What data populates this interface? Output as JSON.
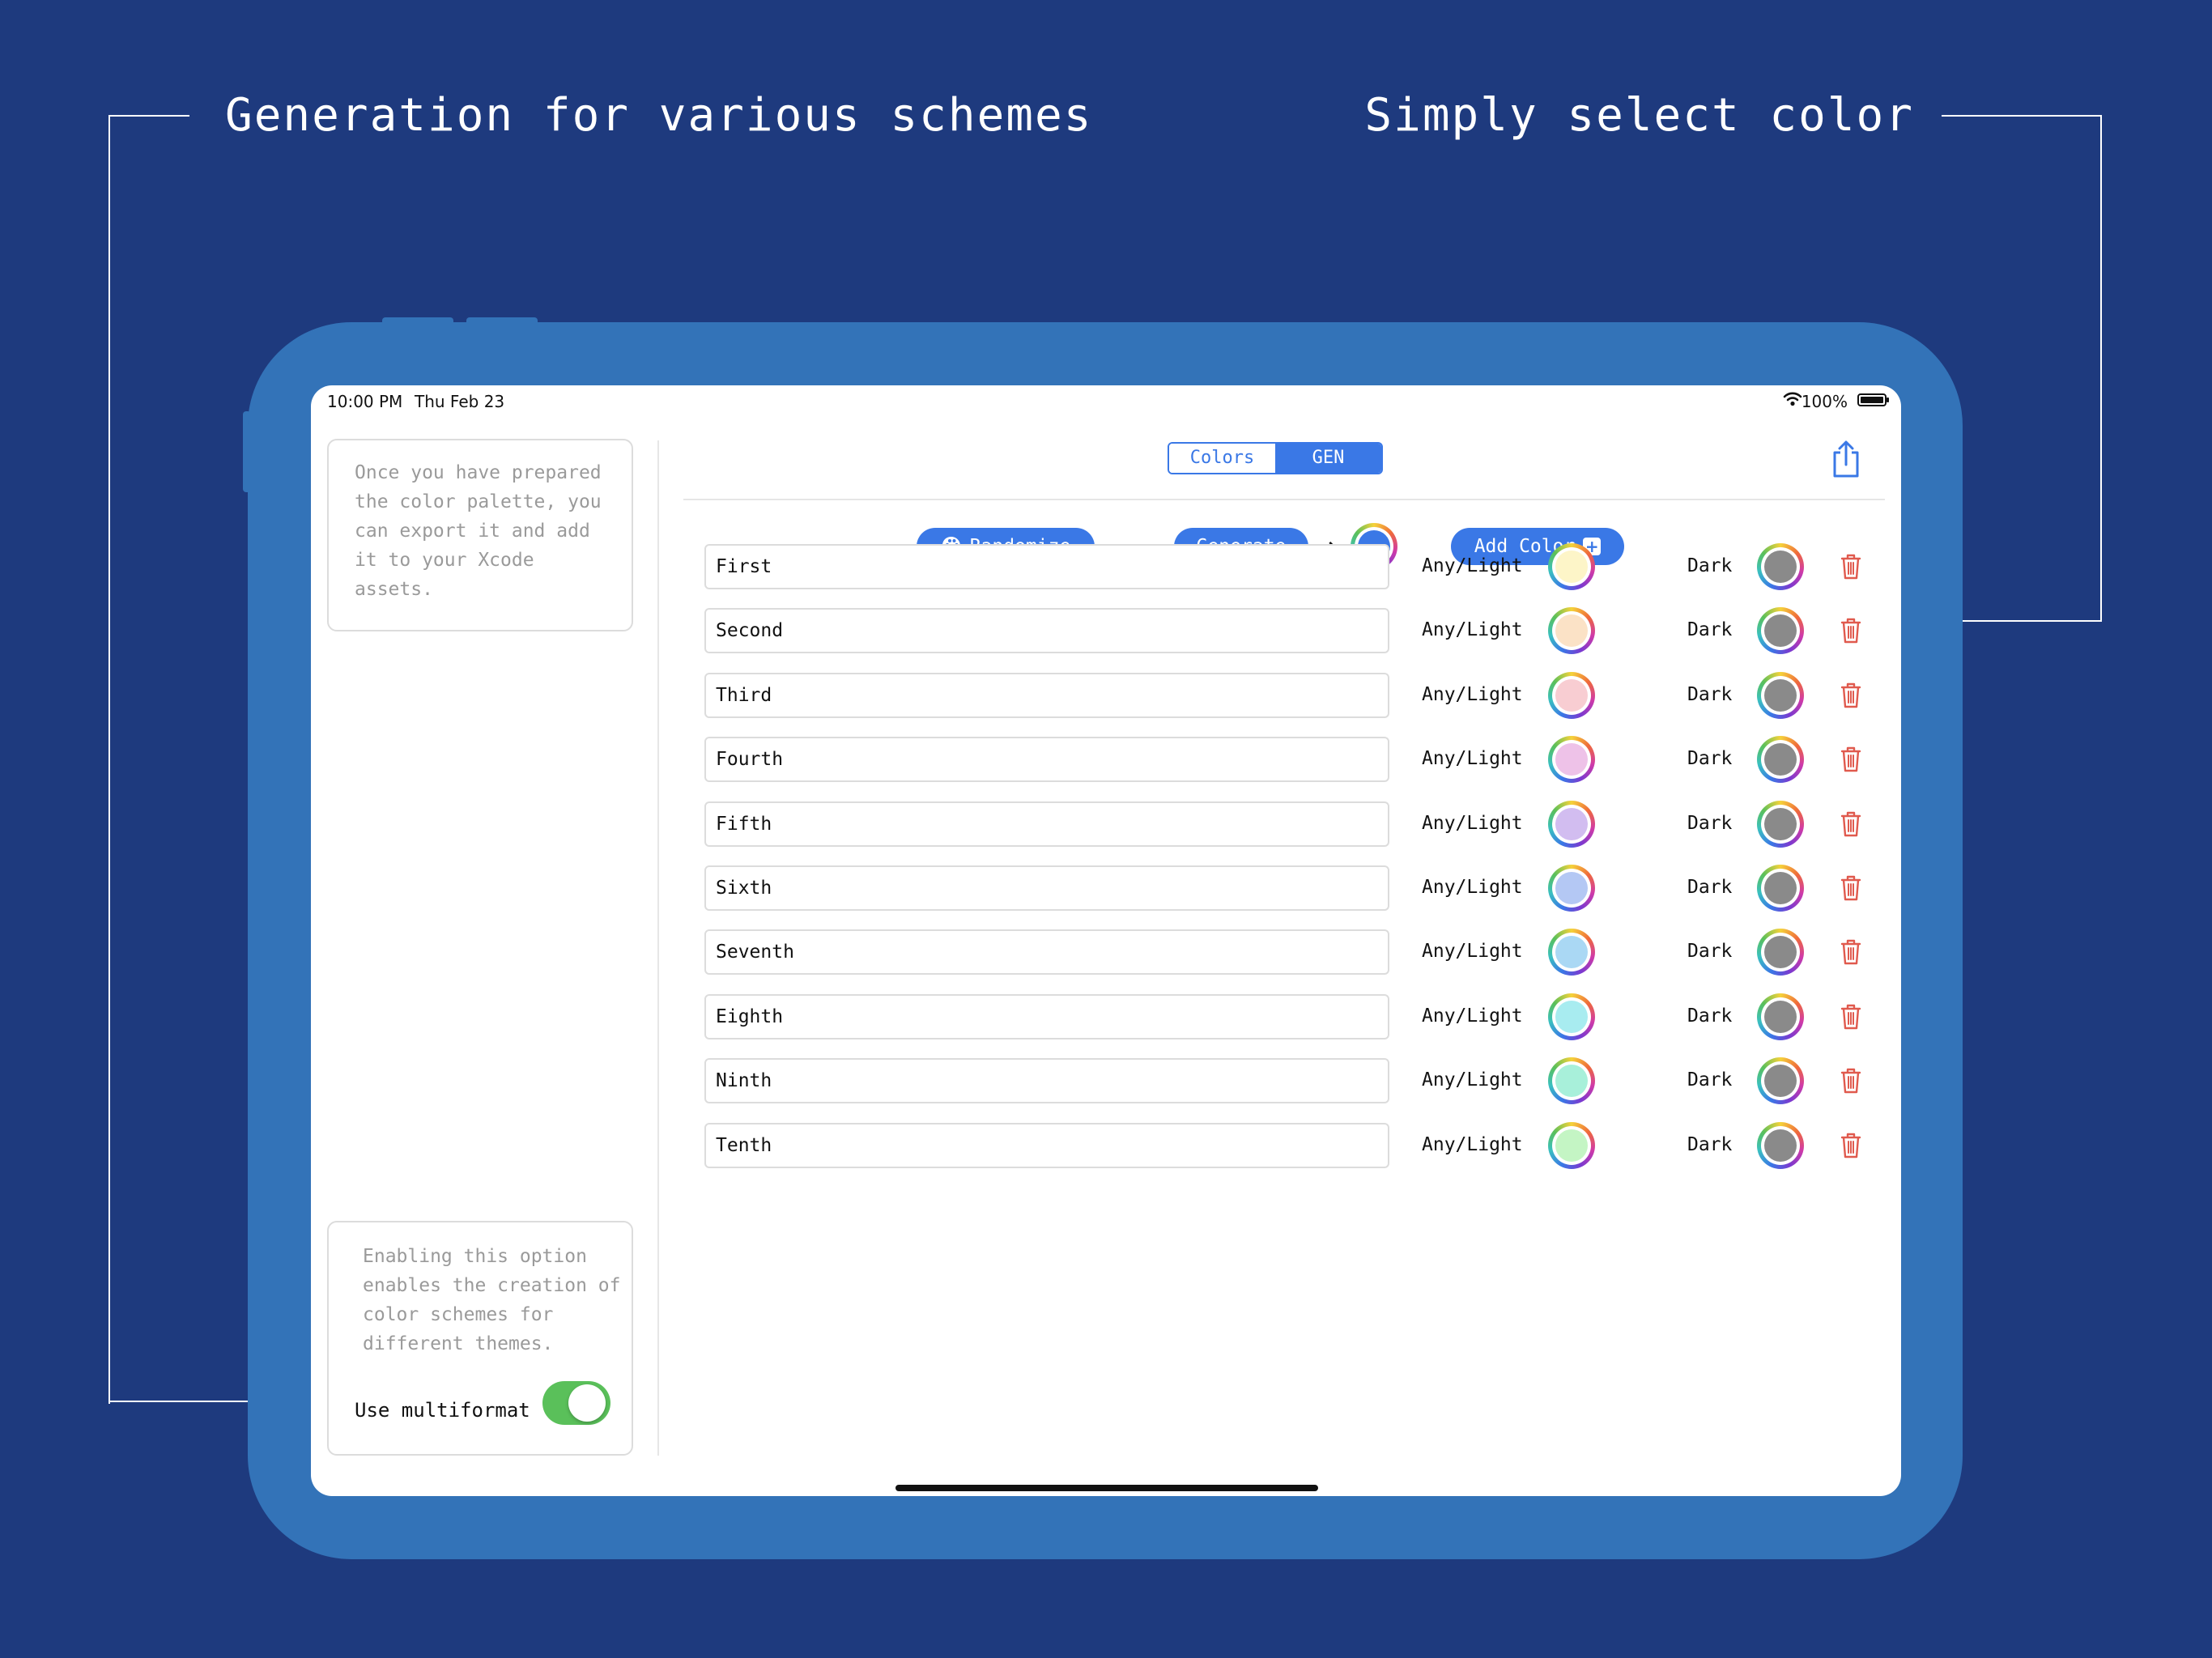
{
  "headlines": {
    "left": "Generation for various schemes",
    "right": "Simply select color"
  },
  "status_bar": {
    "time": "10:00 PM",
    "date": "Thu Feb 23",
    "battery": "100%"
  },
  "sidebar": {
    "export_hint": "Once you have prepared the color palette, you can export it and add it to your Xcode assets.",
    "multiformat_hint": "Enabling this option enables the creation of color schemes for different themes.",
    "multiformat_label": "Use multiformat",
    "multiformat_enabled": true
  },
  "tabs": [
    {
      "label": "Colors",
      "active": false
    },
    {
      "label": "GEN",
      "active": true
    }
  ],
  "toolbar": {
    "randomize_label": "Randomize",
    "generate_label": "Generate",
    "add_color_label": "Add Color",
    "generate_color": "#3a78e6"
  },
  "colors": [
    {
      "name": "First",
      "light_label": "Any/Light",
      "light_color": "#fdf5c8",
      "dark_label": "Dark",
      "dark_color": "#8a8a8a"
    },
    {
      "name": "Second",
      "light_label": "Any/Light",
      "light_color": "#fbe2c6",
      "dark_label": "Dark",
      "dark_color": "#8a8a8a"
    },
    {
      "name": "Third",
      "light_label": "Any/Light",
      "light_color": "#f8cdd2",
      "dark_label": "Dark",
      "dark_color": "#8a8a8a"
    },
    {
      "name": "Fourth",
      "light_label": "Any/Light",
      "light_color": "#eec2e8",
      "dark_label": "Dark",
      "dark_color": "#8a8a8a"
    },
    {
      "name": "Fifth",
      "light_label": "Any/Light",
      "light_color": "#d2bdf0",
      "dark_label": "Dark",
      "dark_color": "#8a8a8a"
    },
    {
      "name": "Sixth",
      "light_label": "Any/Light",
      "light_color": "#b4c8f4",
      "dark_label": "Dark",
      "dark_color": "#8a8a8a"
    },
    {
      "name": "Seventh",
      "light_label": "Any/Light",
      "light_color": "#aad8f4",
      "dark_label": "Dark",
      "dark_color": "#8a8a8a"
    },
    {
      "name": "Eighth",
      "light_label": "Any/Light",
      "light_color": "#a8ecf0",
      "dark_label": "Dark",
      "dark_color": "#8a8a8a"
    },
    {
      "name": "Ninth",
      "light_label": "Any/Light",
      "light_color": "#a8f0da",
      "dark_label": "Dark",
      "dark_color": "#8a8a8a"
    },
    {
      "name": "Tenth",
      "light_label": "Any/Light",
      "light_color": "#c4f5c4",
      "dark_label": "Dark",
      "dark_color": "#8a8a8a"
    }
  ],
  "theme": {
    "background": "#1e3a7e",
    "device": "#3373b8",
    "accent": "#3a78e6",
    "toggle_on": "#5ac05a",
    "delete": "#e05a4e"
  },
  "icons": {
    "share": "share-icon",
    "palette": "palette-icon",
    "arrow": "arrow-right-icon",
    "plus": "plus-square-icon",
    "trash": "trash-icon",
    "wifi": "wifi-icon",
    "battery": "battery-icon"
  }
}
